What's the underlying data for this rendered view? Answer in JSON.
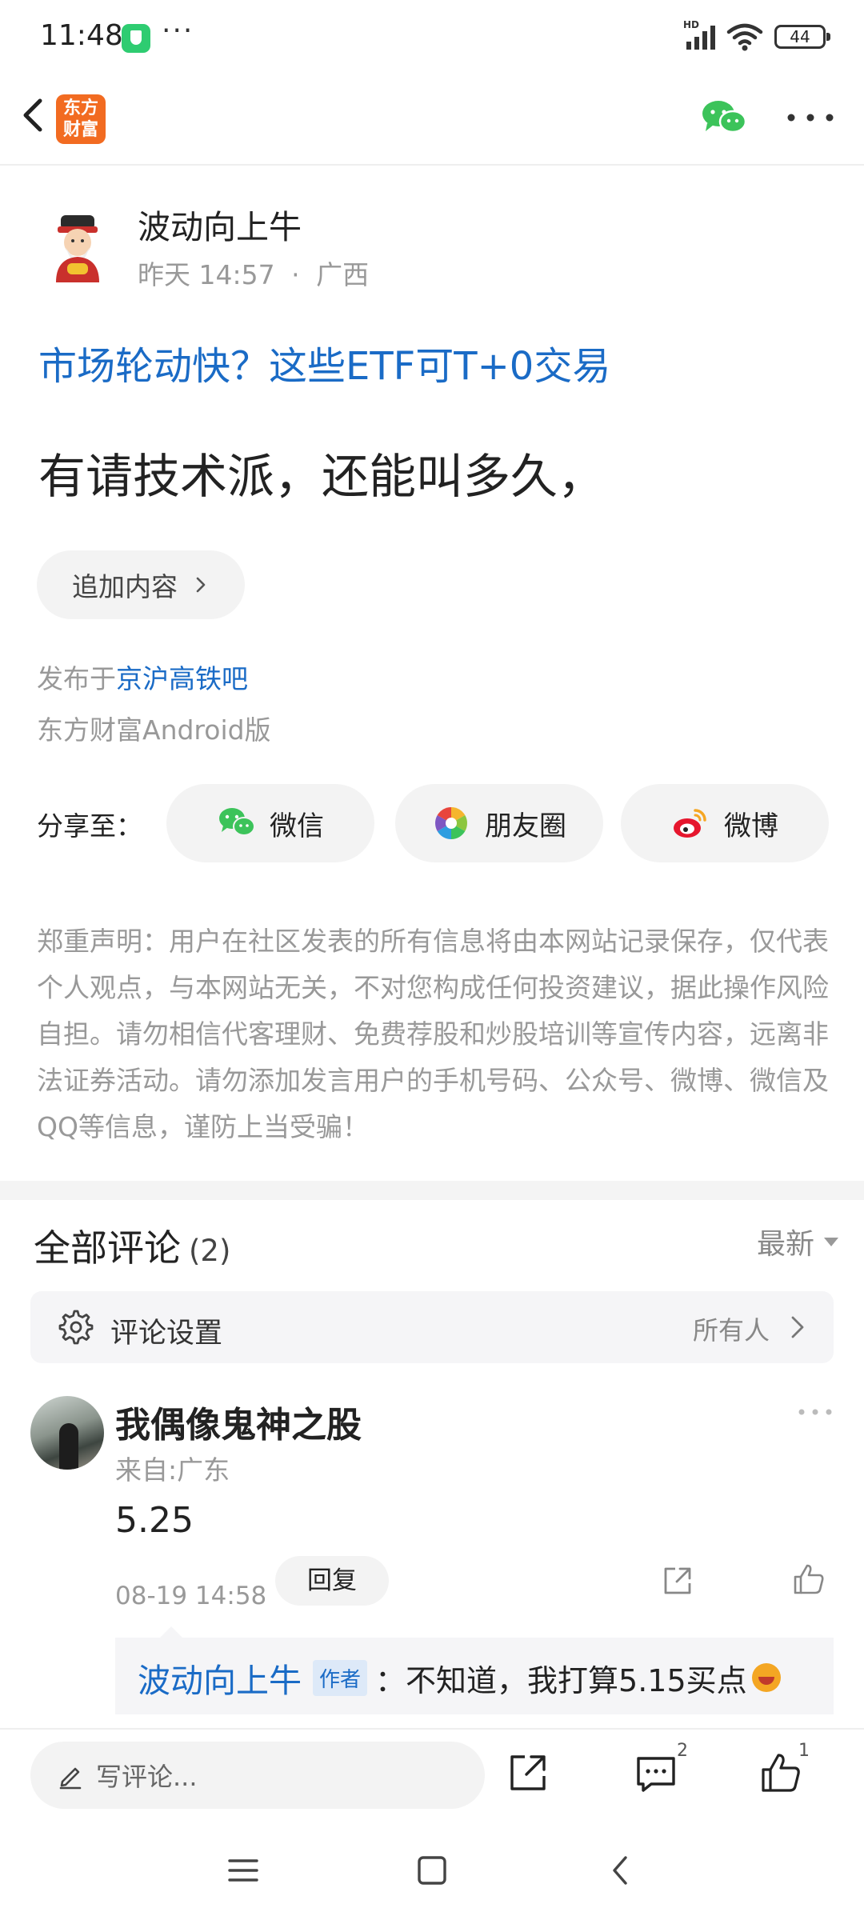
{
  "status_bar": {
    "time": "11:48",
    "more": "···",
    "network": "HD",
    "battery": "44"
  },
  "nav": {
    "app_logo_line1": "东方",
    "app_logo_line2": "财富"
  },
  "post": {
    "author": "波动向上牛",
    "time": "昨天 14:57",
    "separator": "·",
    "location": "广西",
    "topic_link": "市场轮动快？这些ETF可T+0交易",
    "body": "有请技术派，还能叫多久，",
    "append_button": "追加内容",
    "published_prefix": "发布于",
    "bar_name": "京沪高铁吧",
    "client": "东方财富Android版"
  },
  "share": {
    "label": "分享至：",
    "buttons": [
      {
        "label": "微信",
        "icon": "wechat-icon"
      },
      {
        "label": "朋友圈",
        "icon": "moments-icon"
      },
      {
        "label": "微博",
        "icon": "weibo-icon"
      }
    ]
  },
  "disclaimer": "郑重声明：用户在社区发表的所有信息将由本网站记录保存，仅代表个人观点，与本网站无关，不对您构成任何投资建议，据此操作风险自担。请勿相信代客理财、免费荐股和炒股培训等宣传内容，远离非法证券活动。请勿添加发言用户的手机号码、公众号、微博、微信及QQ等信息，谨防上当受骗！",
  "comments": {
    "title": "全部评论",
    "count": "(2)",
    "sort": "最新",
    "settings_label": "评论设置",
    "settings_value": "所有人",
    "items": [
      {
        "user": "我偶像鬼神之股",
        "location": "来自:广东",
        "text": "5.25",
        "time": "08-19 14:58",
        "reply_button": "回复",
        "reply": {
          "author": "波动向上牛",
          "badge": "作者",
          "text": "：不知道，我打算5.15买点"
        }
      }
    ]
  },
  "bottom_bar": {
    "input_placeholder": "写评论...",
    "comment_count": "2",
    "like_count": "1"
  },
  "colors": {
    "link": "#1a6bc6",
    "brand": "#f26b21",
    "wechat_green": "#3cc35a"
  }
}
